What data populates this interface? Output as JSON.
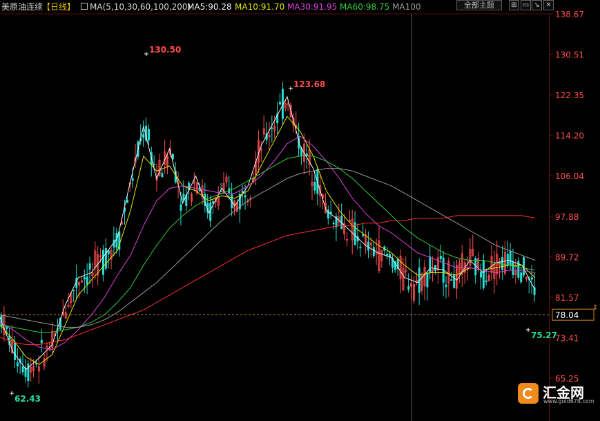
{
  "header": {
    "title": "美原油连续",
    "period": "【日线】",
    "ma_params": "MA(5,10,30,60,100,200)",
    "ma5": "MA5:90.28",
    "ma10": "MA10:91.70",
    "ma30": "MA30:91.95",
    "ma60": "MA60:98.75",
    "ma100": "MA100",
    "theme_button": "全部主题"
  },
  "colors": {
    "background": "#000000",
    "up": "#ff4d4d",
    "down": "#26e0d6",
    "ma5": "#f0f0f0",
    "ma10": "#e6e600",
    "ma30": "#e040e0",
    "ma60": "#2ecc40",
    "ma100": "#9a9a9a",
    "ma200": "#ff3030",
    "price_line": "#d98a2b"
  },
  "chart_data": {
    "type": "line",
    "title": "美原油连续【日线】",
    "y_ticks": [
      "138.67",
      "130.51",
      "122.35",
      "114.20",
      "106.04",
      "97.88",
      "89.72",
      "81.57",
      "73.41",
      "65.25"
    ],
    "ylim": [
      65.25,
      138.67
    ],
    "current_price": "78.04",
    "annotations": [
      {
        "label": "130.50",
        "type": "high"
      },
      {
        "label": "123.68",
        "type": "high"
      },
      {
        "label": "62.43",
        "type": "low"
      },
      {
        "label": "75.27",
        "type": "low"
      }
    ],
    "series": [
      {
        "name": "MA5",
        "value_label": "90.28",
        "values": [
          77.5,
          70.5,
          67.0,
          69.3,
          72.0,
          80.0,
          85.5,
          86.5,
          90.0,
          93.5,
          105.0,
          116.0,
          105.5,
          111.5,
          100.5,
          106.0,
          98.5,
          103.5,
          100.0,
          104.0,
          112.0,
          117.0,
          122.0,
          112.0,
          107.5,
          99.0,
          97.0,
          94.5,
          92.0,
          90.5,
          89.5,
          85.5,
          84.5,
          87.5,
          87.0,
          85.0,
          89.0,
          86.5,
          88.5,
          89.0,
          88.0,
          83.0
        ]
      },
      {
        "name": "MA10",
        "value_label": "91.70",
        "values": [
          76.0,
          73.0,
          69.5,
          68.0,
          70.0,
          76.0,
          82.0,
          85.0,
          88.0,
          91.0,
          99.0,
          110.0,
          107.0,
          108.0,
          104.0,
          103.0,
          101.0,
          102.0,
          101.5,
          103.0,
          108.0,
          113.0,
          118.0,
          115.0,
          110.0,
          103.0,
          99.0,
          96.0,
          94.0,
          92.0,
          90.5,
          88.0,
          86.0,
          86.5,
          86.5,
          86.0,
          87.5,
          87.0,
          87.5,
          88.0,
          88.0,
          85.5
        ]
      },
      {
        "name": "MA30",
        "value_label": "91.95",
        "values": [
          76.5,
          75.0,
          73.0,
          71.5,
          71.0,
          72.5,
          75.0,
          78.0,
          81.5,
          86.0,
          90.0,
          96.0,
          101.0,
          103.5,
          104.0,
          103.5,
          103.0,
          102.5,
          102.5,
          104.0,
          106.0,
          109.0,
          112.5,
          114.0,
          112.0,
          109.0,
          105.5,
          101.5,
          98.5,
          96.0,
          94.5,
          92.5,
          90.5,
          89.5,
          88.5,
          87.5,
          87.5,
          87.0,
          86.5,
          87.0,
          87.0,
          86.5
        ]
      },
      {
        "name": "MA60",
        "value_label": "98.75",
        "values": [
          76.0,
          75.5,
          75.0,
          74.5,
          74.5,
          75.0,
          75.5,
          76.5,
          78.0,
          80.5,
          83.5,
          88.0,
          92.0,
          95.5,
          98.0,
          100.0,
          101.5,
          102.5,
          103.5,
          105.0,
          106.5,
          108.0,
          109.5,
          110.0,
          110.0,
          109.0,
          107.5,
          105.5,
          103.0,
          100.5,
          98.0,
          95.5,
          93.5,
          92.0,
          90.5,
          89.5,
          89.0,
          89.0,
          88.5,
          88.0,
          87.5,
          87.0
        ]
      },
      {
        "name": "MA100",
        "values": [
          78.0,
          77.5,
          77.0,
          76.5,
          76.0,
          75.5,
          75.5,
          76.0,
          77.0,
          78.5,
          80.5,
          82.5,
          84.5,
          87.0,
          89.5,
          92.0,
          94.5,
          97.0,
          99.0,
          101.0,
          102.5,
          104.0,
          105.5,
          106.5,
          107.0,
          107.5,
          107.5,
          107.0,
          106.0,
          105.0,
          104.0,
          102.5,
          101.0,
          99.5,
          98.0,
          96.5,
          95.0,
          93.5,
          92.0,
          91.0,
          90.0,
          89.0
        ]
      },
      {
        "name": "MA200",
        "values": [
          73.5,
          72.5,
          72.0,
          72.0,
          72.5,
          73.0,
          74.0,
          75.0,
          76.0,
          77.0,
          78.0,
          79.0,
          80.5,
          82.0,
          83.5,
          85.0,
          86.5,
          88.0,
          89.5,
          91.0,
          92.0,
          93.0,
          94.0,
          94.5,
          95.0,
          95.5,
          96.0,
          96.0,
          96.5,
          96.5,
          97.0,
          97.0,
          97.5,
          97.5,
          97.5,
          98.0,
          98.0,
          98.0,
          98.0,
          98.0,
          98.0,
          97.5
        ]
      }
    ]
  },
  "branding": {
    "name": "汇金网",
    "url": "www.gold678.com"
  }
}
